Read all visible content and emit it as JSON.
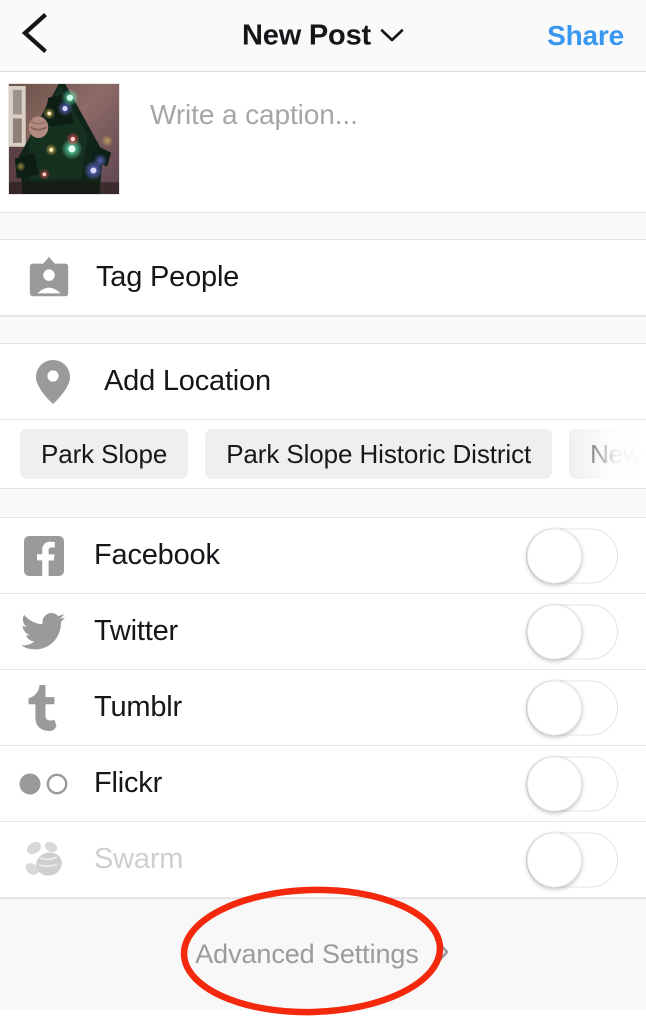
{
  "navbar": {
    "back_icon": "chevron-left-icon",
    "title": "New Post",
    "title_chevron_icon": "chevron-down-icon",
    "share_label": "Share"
  },
  "caption": {
    "thumbnail_alt": "christmas-tree-photo-thumbnail",
    "placeholder": "Write a caption..."
  },
  "tag_people": {
    "icon": "person-badge-icon",
    "label": "Tag People"
  },
  "add_location": {
    "icon": "map-pin-icon",
    "label": "Add Location"
  },
  "location_suggestions": [
    {
      "label": "Park Slope",
      "faded": false
    },
    {
      "label": "Park Slope Historic District",
      "faded": false
    },
    {
      "label": "New Yor",
      "faded": true
    }
  ],
  "share_targets": [
    {
      "label": "Facebook",
      "icon": "facebook-icon",
      "enabled": true,
      "toggle_on": false
    },
    {
      "label": "Twitter",
      "icon": "twitter-icon",
      "enabled": true,
      "toggle_on": false
    },
    {
      "label": "Tumblr",
      "icon": "tumblr-icon",
      "enabled": true,
      "toggle_on": false
    },
    {
      "label": "Flickr",
      "icon": "flickr-icon",
      "enabled": true,
      "toggle_on": false
    },
    {
      "label": "Swarm",
      "icon": "swarm-icon",
      "enabled": false,
      "toggle_on": false
    }
  ],
  "footer": {
    "label": "Advanced Settings",
    "chevron_icon": "chevron-right-icon"
  },
  "annotation": {
    "shape": "ellipse",
    "color": "#F4280C",
    "target": "Advanced Settings"
  },
  "colors": {
    "share_blue": "#3897F0",
    "annotation_red": "#F4280C",
    "icon_gray": "#9A9A9A",
    "text_dark": "#15161A",
    "text_muted": "#9B9B9B",
    "chip_bg": "#EFEFEF",
    "band_bg": "#FAFAFA"
  }
}
